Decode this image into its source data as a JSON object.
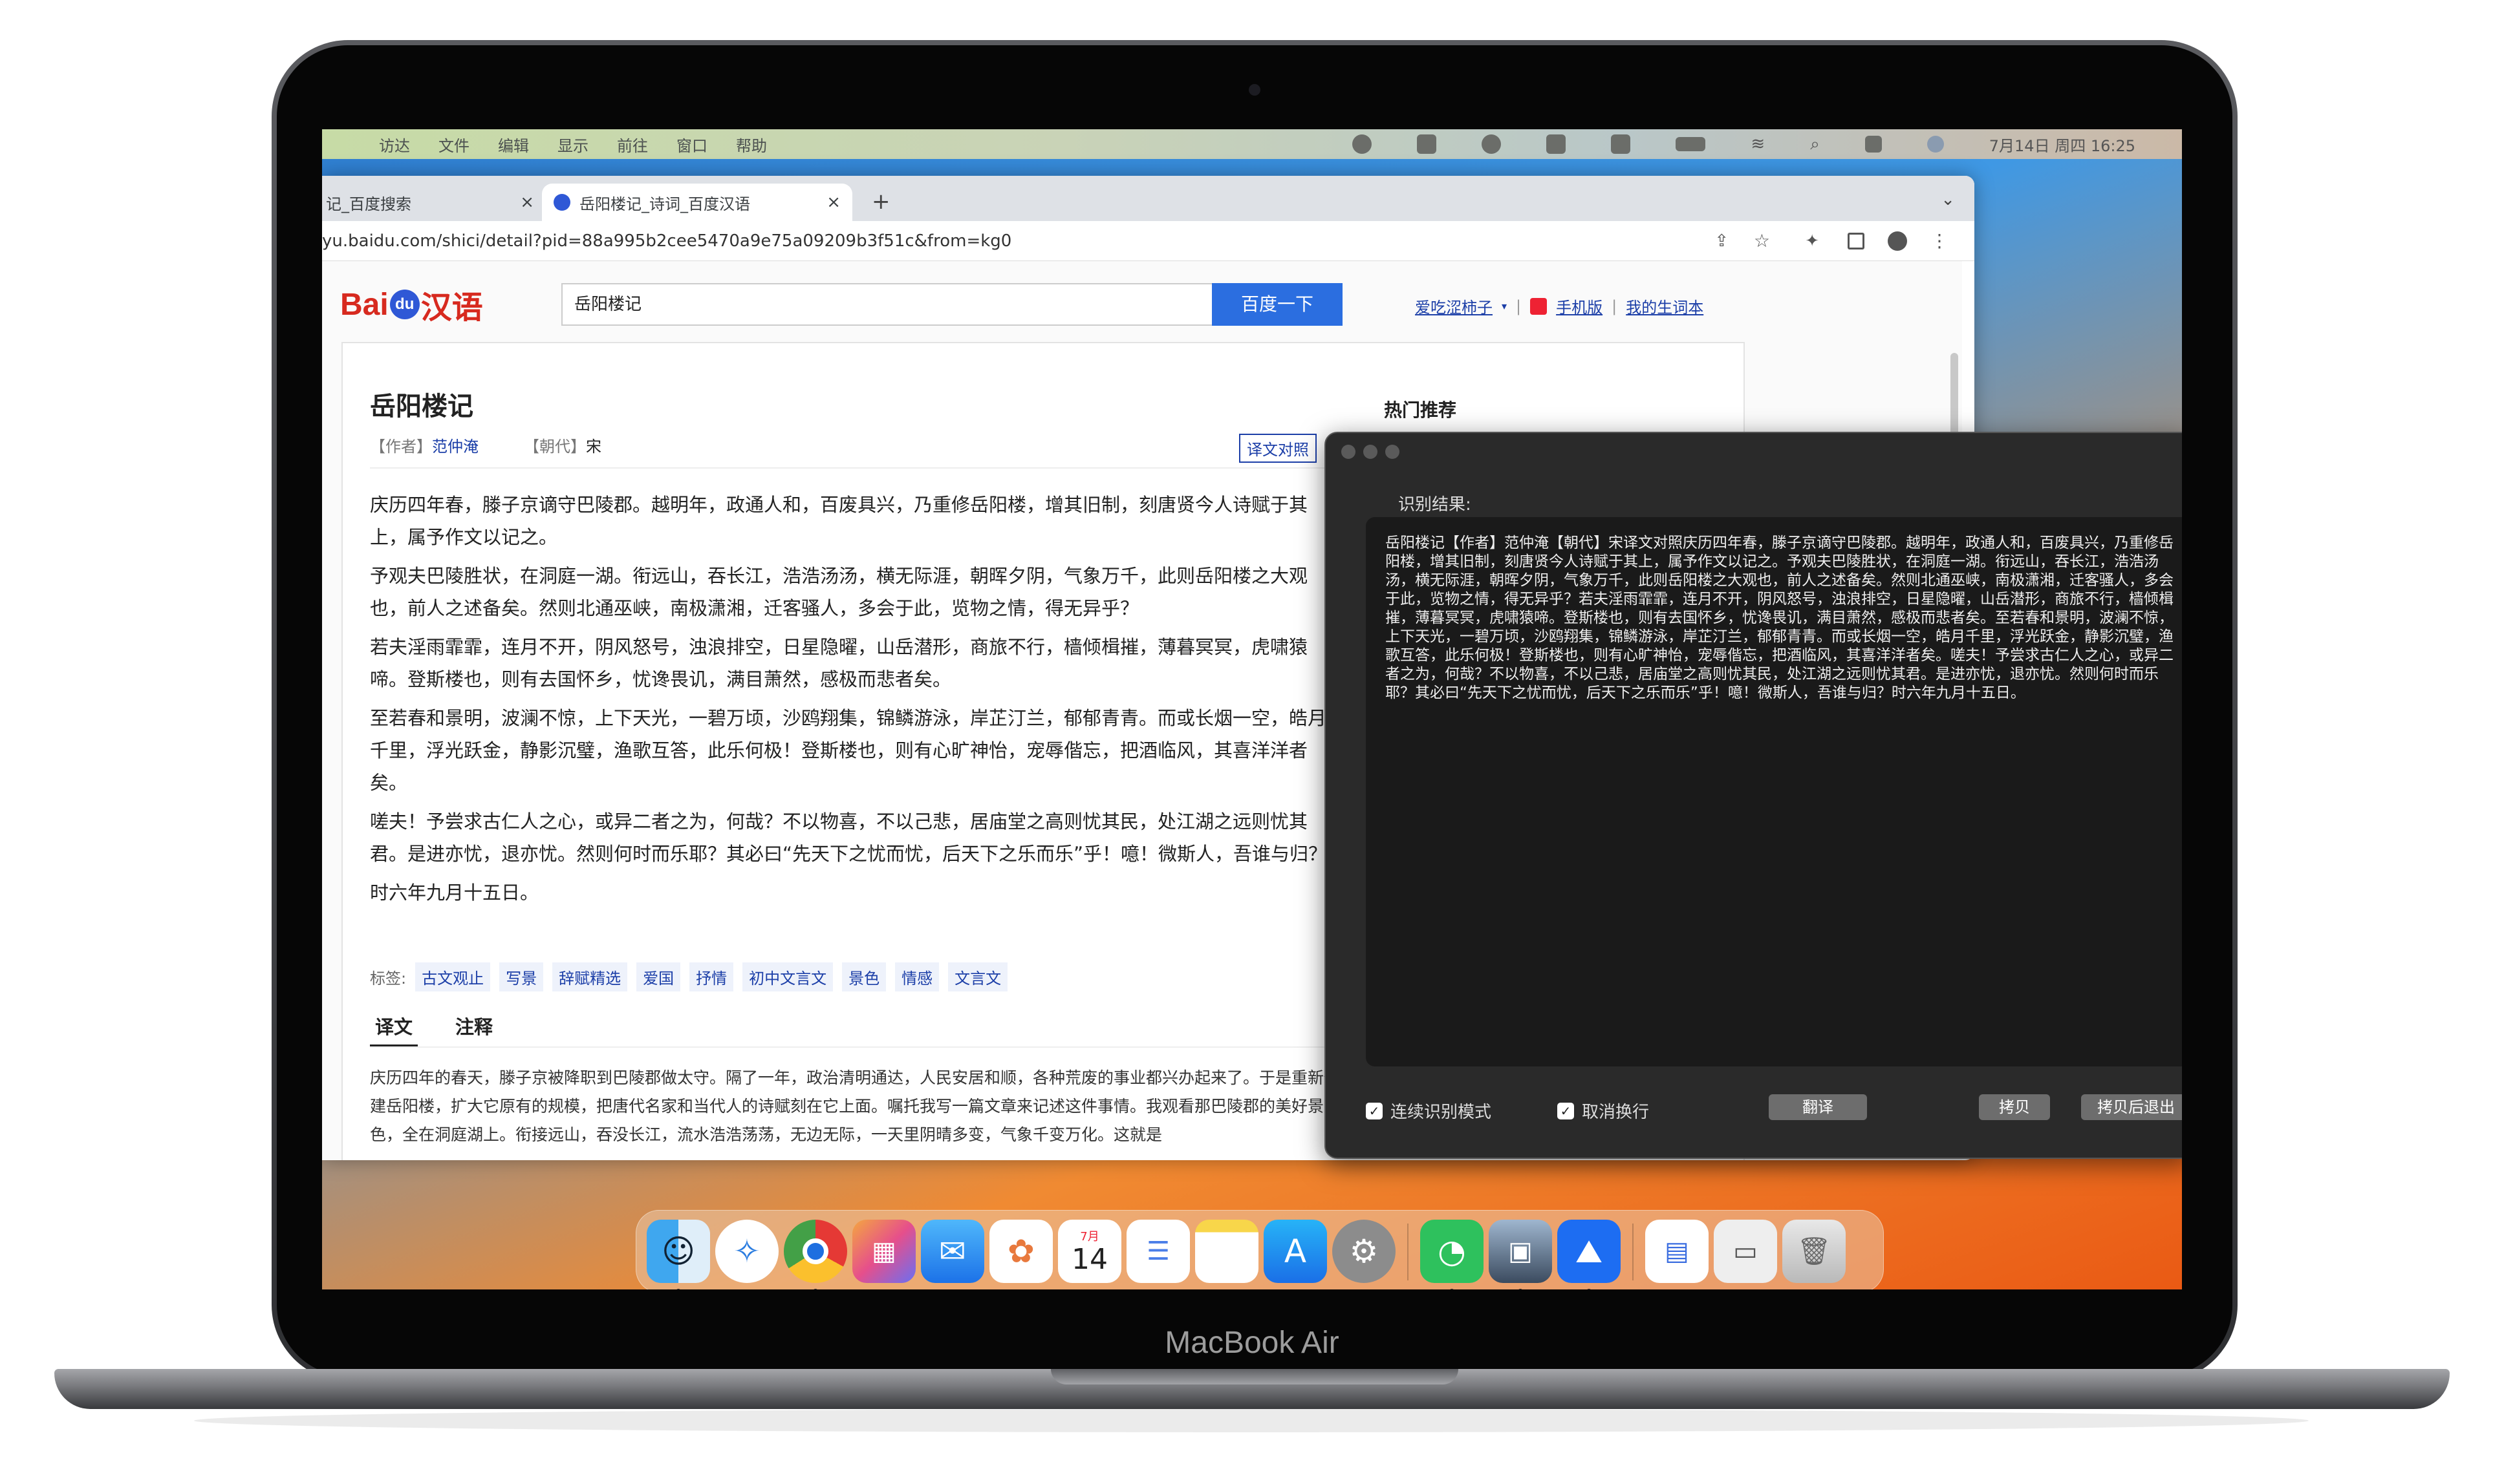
{
  "menubar": {
    "apple": "",
    "items": [
      "访达",
      "文件",
      "编辑",
      "显示",
      "前往",
      "窗口",
      "帮助"
    ],
    "clock": "7月14日 周四 16:25"
  },
  "browser": {
    "tabs": [
      {
        "label": "记_百度搜索"
      },
      {
        "label": "岳阳楼记_诗词_百度汉语"
      }
    ],
    "url": "yu.baidu.com/shici/detail?pid=88a995b2cee5470a9e75a09209b3f51c&from=kg0"
  },
  "site": {
    "logo_prefix": "Bai",
    "logo_circle": "du",
    "logo_suffix": "汉语",
    "search_value": "岳阳楼记",
    "search_button": "百度一下",
    "links": [
      "爱吃涩柿子",
      "手机版",
      "我的生词本"
    ],
    "hot_title": "热门推荐"
  },
  "poem": {
    "title": "岳阳楼记",
    "author_label": "【作者】",
    "author": "范仲淹",
    "dynasty_label": "【朝代】",
    "dynasty": "宋",
    "contrast_button": "译文对照",
    "paragraphs": [
      "庆历四年春，滕子京谪守巴陵郡。越明年，政通人和，百废具兴，乃重修岳阳楼，增其旧制，刻唐贤今人诗赋于其上，属予作文以记之。",
      "予观夫巴陵胜状，在洞庭一湖。衔远山，吞长江，浩浩汤汤，横无际涯，朝晖夕阴，气象万千，此则岳阳楼之大观也，前人之述备矣。然则北通巫峡，南极潇湘，迁客骚人，多会于此，览物之情，得无异乎？",
      "若夫淫雨霏霏，连月不开，阴风怒号，浊浪排空，日星隐曜，山岳潜形，商旅不行，樯倾楫摧，薄暮冥冥，虎啸猿啼。登斯楼也，则有去国怀乡，忧谗畏讥，满目萧然，感极而悲者矣。",
      "至若春和景明，波澜不惊，上下天光，一碧万顷，沙鸥翔集，锦鳞游泳，岸芷汀兰，郁郁青青。而或长烟一空，皓月千里，浮光跃金，静影沉璧，渔歌互答，此乐何极！登斯楼也，则有心旷神怡，宠辱偕忘，把酒临风，其喜洋洋者矣。",
      "嗟夫！予尝求古仁人之心，或异二者之为，何哉？不以物喜，不以己悲，居庙堂之高则忧其民，处江湖之远则忧其君。是进亦忧，退亦忧。然则何时而乐耶？其必曰“先天下之忧而忧，后天下之乐而乐”乎！噫！微斯人，吾谁与归？",
      "时六年九月十五日。"
    ],
    "tags_label": "标签:",
    "tags": [
      "古文观止",
      "写景",
      "辞赋精选",
      "爱国",
      "抒情",
      "初中文言文",
      "景色",
      "情感",
      "文言文"
    ],
    "tab_translation": "译文",
    "tab_notes": "注释",
    "translation": "庆历四年的春天，滕子京被降职到巴陵郡做太守。隔了一年，政治清明通达，人民安居和顺，各种荒废的事业都兴办起来了。于是重新修建岳阳楼，扩大它原有的规模，把唐代名家和当代人的诗赋刻在它上面。嘱托我写一篇文章来记述这件事情。我观看那巴陵郡的美好景色，全在洞庭湖上。衔接远山，吞没长江，流水浩浩荡荡，无边无际，一天里阴晴多变，气象千变万化。这就是"
  },
  "ocr": {
    "label": "识别结果:",
    "text": "岳阳楼记【作者】范仲淹【朝代】宋译文对照庆历四年春，滕子京谪守巴陵郡。越明年，政通人和，百废具兴，乃重修岳阳楼，增其旧制，刻唐贤今人诗赋于其上，属予作文以记之。予观夫巴陵胜状，在洞庭一湖。衔远山，吞长江，浩浩汤汤，横无际涯，朝晖夕阴，气象万千，此则岳阳楼之大观也，前人之述备矣。然则北通巫峡，南极潇湘，迁客骚人，多会于此，览物之情，得无异乎？若夫淫雨霏霏，连月不开，阴风怒号，浊浪排空，日星隐曜，山岳潜形，商旅不行，樯倾楫摧，薄暮冥冥，虎啸猿啼。登斯楼也，则有去国怀乡，忧谗畏讥，满目萧然，感极而悲者矣。至若春和景明，波澜不惊，上下天光，一碧万顷，沙鸥翔集，锦鳞游泳，岸芷汀兰，郁郁青青。而或长烟一空，皓月千里，浮光跃金，静影沉璧，渔歌互答，此乐何极！登斯楼也，则有心旷神怡，宠辱偕忘，把酒临风，其喜洋洋者矣。嗟夫！予尝求古仁人之心，或异二者之为，何哉？不以物喜，不以己悲，居庙堂之高则忧其民，处江湖之远则忧其君。是进亦忧，退亦忧。然则何时而乐耶？其必曰“先天下之忧而忧，后天下之乐而乐”乎！噫！微斯人，吾谁与归？时六年九月十五日。",
    "continuous_mode": "连续识别模式",
    "cancel_linebreak": "取消换行",
    "translate_button": "翻译",
    "copy_button": "拷贝",
    "copy_exit_button": "拷贝后退出"
  },
  "dock": {
    "calendar_month": "7月",
    "calendar_day": "14",
    "icons": [
      "finder-icon",
      "safari-icon",
      "chrome-icon",
      "launchpad-icon",
      "mail-icon",
      "photos-icon",
      "calendar-icon",
      "reminders-icon",
      "notes-icon",
      "app-store-icon",
      "system-preferences-icon",
      "wechat-icon",
      "preview-icon",
      "lark-icon",
      "document-icon",
      "screenshot-icon",
      "trash-icon"
    ]
  },
  "laptop": {
    "model": "MacBook Air"
  }
}
